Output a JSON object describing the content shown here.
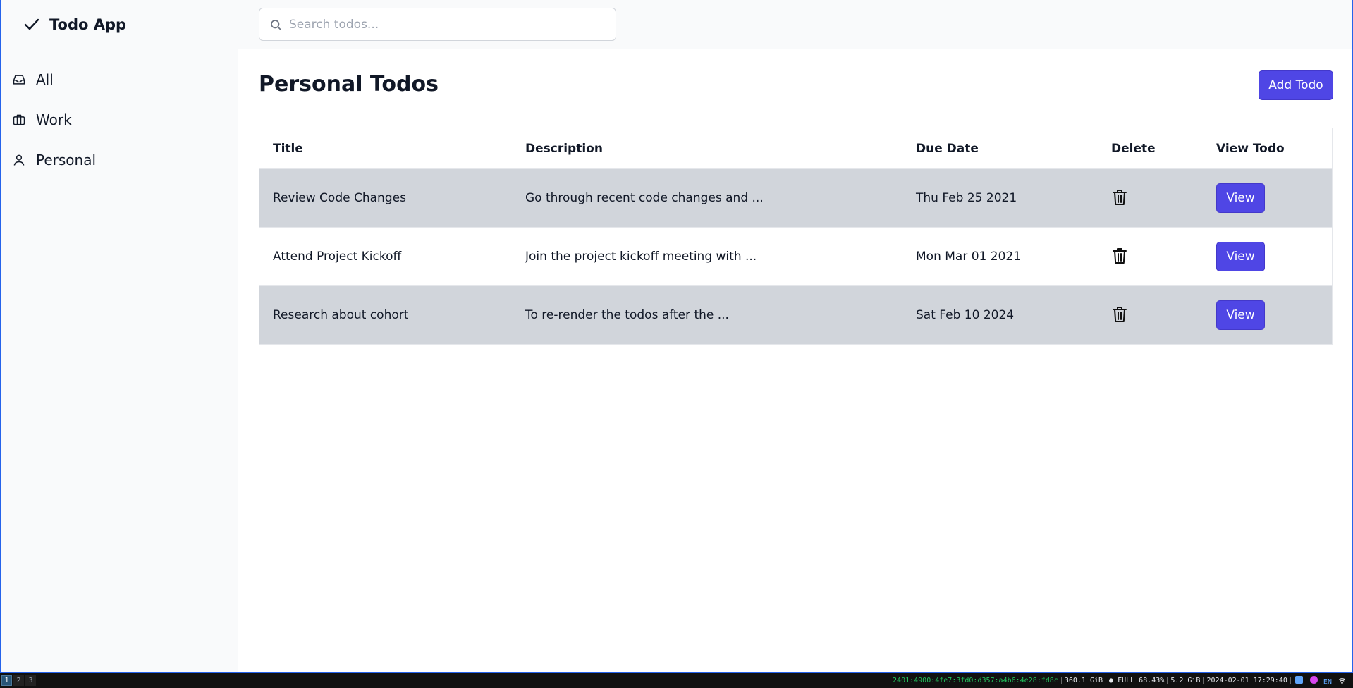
{
  "app": {
    "title": "Todo App"
  },
  "sidebar": {
    "items": [
      {
        "label": "All",
        "icon": "inbox-icon"
      },
      {
        "label": "Work",
        "icon": "briefcase-icon"
      },
      {
        "label": "Personal",
        "icon": "user-icon"
      }
    ]
  },
  "search": {
    "placeholder": "Search todos...",
    "value": ""
  },
  "main": {
    "title": "Personal Todos",
    "add_label": "Add Todo"
  },
  "table": {
    "headers": [
      "Title",
      "Description",
      "Due Date",
      "Delete",
      "View Todo"
    ],
    "rows": [
      {
        "title": "Review Code Changes",
        "description": "Go through recent code changes and ...",
        "due": "Thu Feb 25 2021",
        "view_label": "View"
      },
      {
        "title": "Attend Project Kickoff",
        "description": "Join the project kickoff meeting with ...",
        "due": "Mon Mar 01 2021",
        "view_label": "View"
      },
      {
        "title": "Research about cohort",
        "description": "To re-render the todos after the ...",
        "due": "Sat Feb 10 2024",
        "view_label": "View"
      }
    ]
  },
  "taskbar": {
    "workspaces": [
      "1",
      "2",
      "3"
    ],
    "ip": "2401:4900:4fe7:3fd0:d357:a4b6:4e28:fd8c",
    "disk": "360.1 GiB",
    "battery": "FULL 68.43%",
    "memory": "5.2 GiB",
    "datetime": "2024-02-01 17:29:40",
    "lang": "EN"
  },
  "colors": {
    "accent": "#4f46e5",
    "row_shade": "#d1d5db",
    "sidebar_bg": "#f9fafb"
  }
}
